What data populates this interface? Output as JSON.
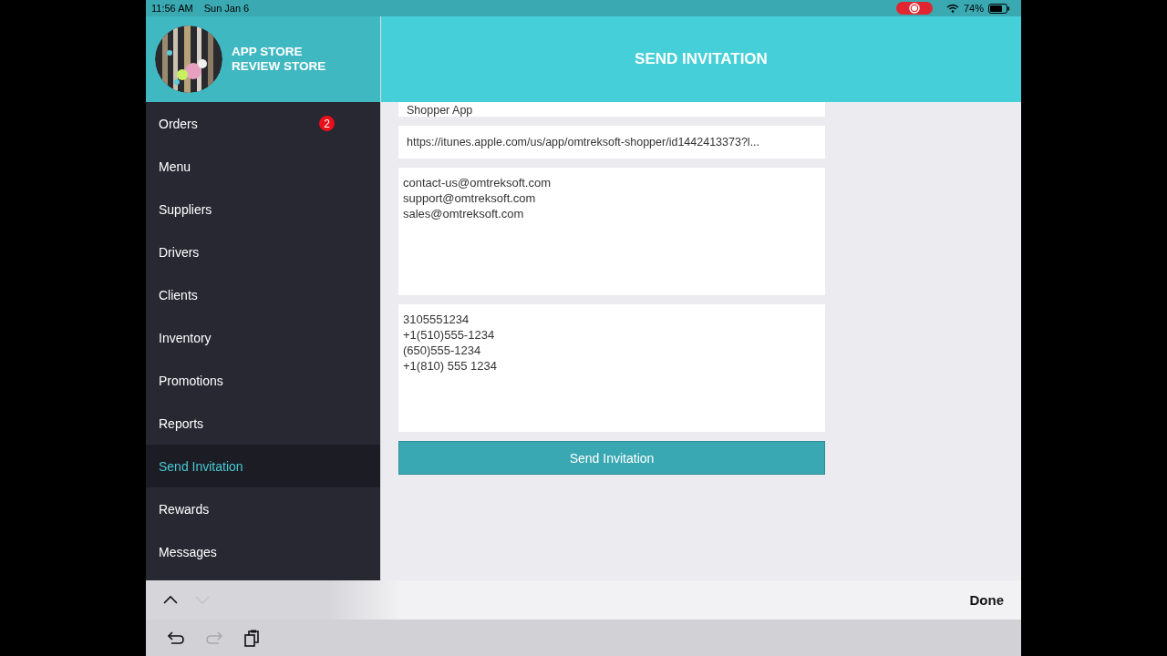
{
  "status_bar": {
    "time": "11:56 AM",
    "date": "Sun Jan 6",
    "recording": true,
    "battery_text": "74%"
  },
  "sidebar": {
    "store_name": [
      "APP STORE",
      "REVIEW STORE"
    ],
    "items": [
      {
        "label": "Orders",
        "selected": false,
        "badge": "2"
      },
      {
        "label": "Menu",
        "selected": false
      },
      {
        "label": "Suppliers",
        "selected": false
      },
      {
        "label": "Drivers",
        "selected": false
      },
      {
        "label": "Clients",
        "selected": false
      },
      {
        "label": "Inventory",
        "selected": false
      },
      {
        "label": "Promotions",
        "selected": false
      },
      {
        "label": "Reports",
        "selected": false
      },
      {
        "label": "Send Invitation",
        "selected": true
      },
      {
        "label": "Rewards",
        "selected": false
      },
      {
        "label": "Messages",
        "selected": false
      }
    ]
  },
  "header": {
    "title": "SEND INVITATION"
  },
  "form": {
    "fields": [
      {
        "kind": "line",
        "value": "Shopper App",
        "scrolled_under": true
      },
      {
        "kind": "line",
        "value": "https://itunes.apple.com/us/app/omtreksoft-shopper/id1442413373?l..."
      },
      {
        "kind": "multiline",
        "lines": [
          "contact-us@omtreksoft.com",
          "support@omtreksoft.com",
          "sales@omtreksoft.com"
        ]
      },
      {
        "kind": "multiline",
        "lines": [
          "3105551234",
          "+1(510)555-1234",
          "(650)555-1234",
          "+1(810) 555 1234"
        ]
      }
    ],
    "button": "Send Invitation"
  },
  "keyboard_bar": {
    "arrows": [
      {
        "kind": "up",
        "disabled": false
      },
      {
        "kind": "down",
        "disabled": true
      }
    ],
    "done": "Done",
    "shortcuts": [
      {
        "kind": "undo",
        "disabled": false
      },
      {
        "kind": "redo",
        "disabled": true
      },
      {
        "kind": "paste",
        "disabled": false
      }
    ]
  }
}
